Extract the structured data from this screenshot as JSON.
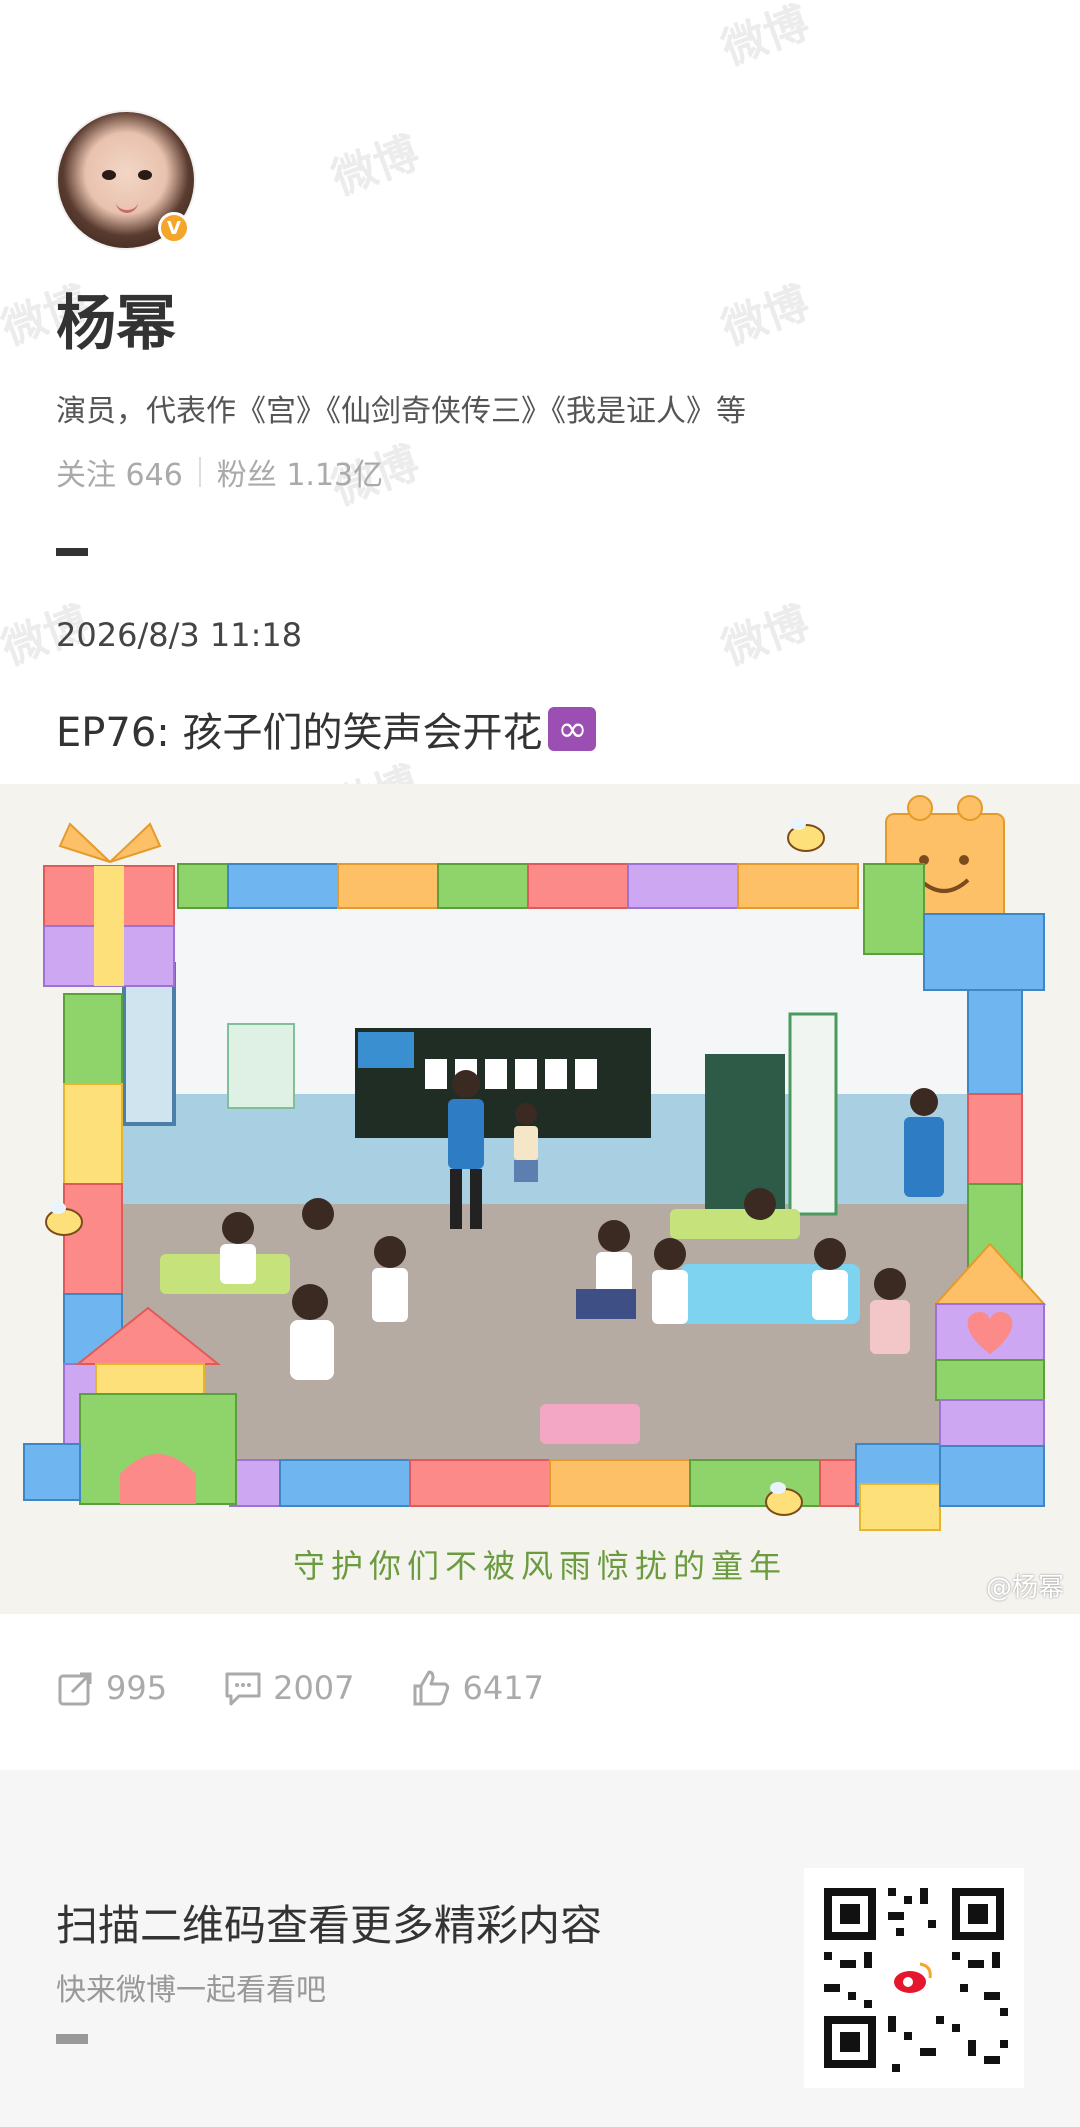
{
  "profile": {
    "name": "杨幂",
    "bio": "演员，代表作《宫》《仙剑奇侠传三》《我是证人》等",
    "following_label": "关注 646",
    "followers_label": "粉丝 1.13亿",
    "verified_badge": "V"
  },
  "post": {
    "date": "2026/8/3 11:18",
    "title": "EP76: 孩子们的笑声会开花",
    "title_emoji": "∞",
    "image_caption": "守护你们不被风雨惊扰的童年",
    "image_watermark": "@杨幂"
  },
  "actions": {
    "repost_count": "995",
    "comment_count": "2007",
    "like_count": "6417"
  },
  "footer": {
    "title": "扫描二维码查看更多精彩内容",
    "subtitle": "快来微博一起看看吧"
  },
  "watermark_text": "微博",
  "colors": {
    "accent_green": "#6b9b3f",
    "badge_orange": "#f4a52b",
    "emoji_purple": "#9b4fb3"
  }
}
